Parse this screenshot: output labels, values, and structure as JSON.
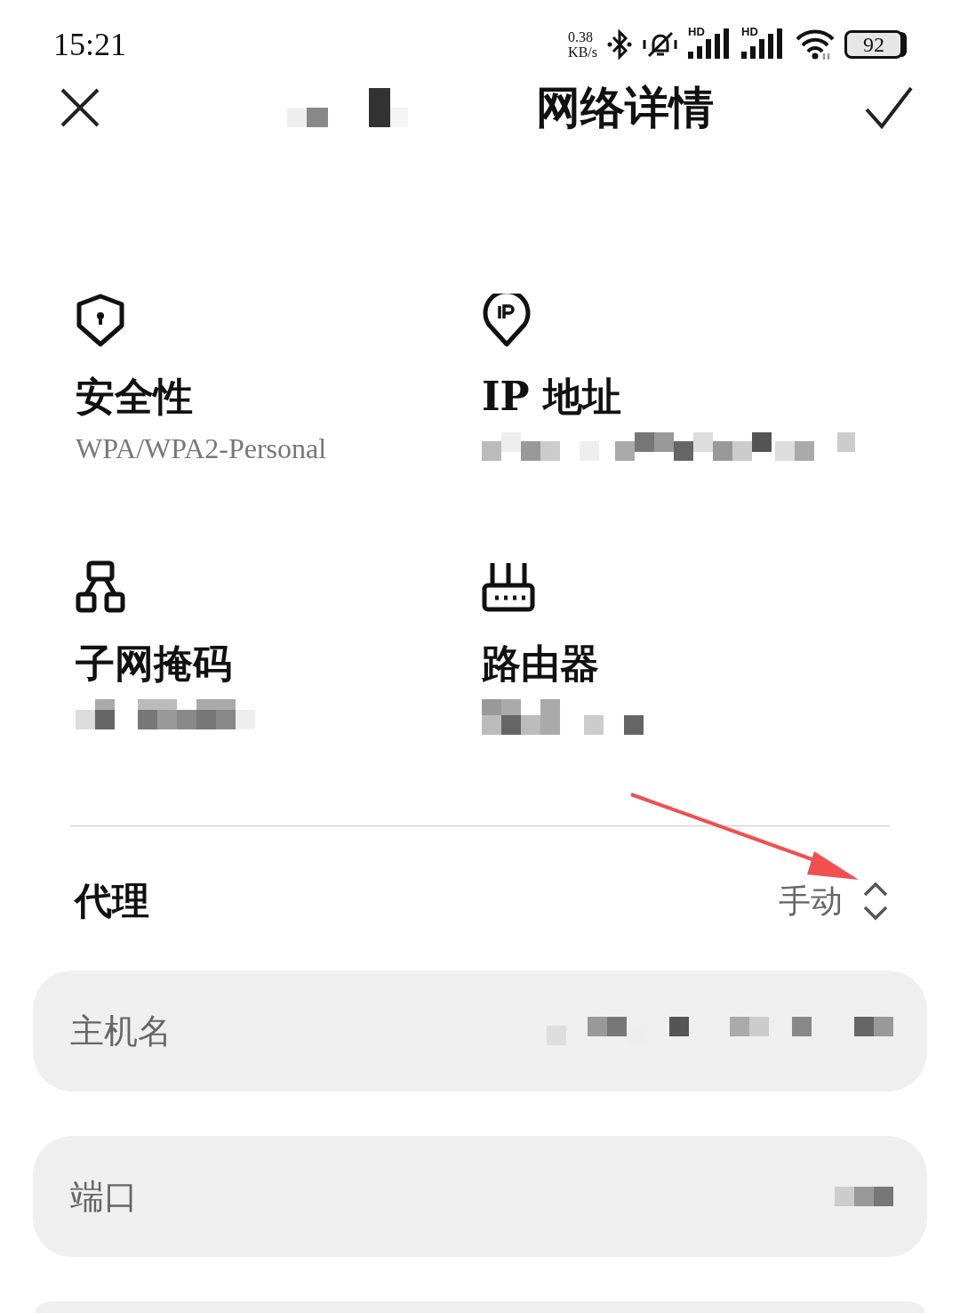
{
  "status_bar": {
    "time": "15:21",
    "net_speed": "0.38",
    "net_unit": "KB/s",
    "sim_badges": [
      "HD",
      "HD"
    ],
    "battery": "92"
  },
  "header": {
    "title": "网络详情"
  },
  "info_items": [
    {
      "kind": "security",
      "label": "安全性",
      "value": "WPA/WPA2-Personal"
    },
    {
      "kind": "ip",
      "label": "IP 地址"
    },
    {
      "kind": "subnet",
      "label": "子网掩码"
    },
    {
      "kind": "router",
      "label": "路由器"
    }
  ],
  "proxy": {
    "label": "代理",
    "value": "手动"
  },
  "fields": [
    {
      "label": "主机名"
    },
    {
      "label": "端口"
    }
  ]
}
